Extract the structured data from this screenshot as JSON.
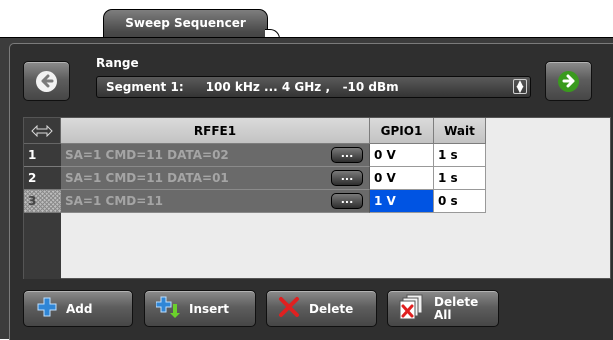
{
  "tab": {
    "label": "Sweep Sequencer"
  },
  "range": {
    "label": "Range",
    "segment_prefix": "Segment 1:",
    "segment_value": "100 kHz ... 4 GHz ,   -10 dBm"
  },
  "table": {
    "columns": {
      "rffe": "RFFE1",
      "gpio": "GPIO1",
      "wait": "Wait"
    },
    "rows": [
      {
        "num": "1",
        "rffe": "SA=1 CMD=11 DATA=02",
        "gpio": "0 V",
        "wait": "1 s"
      },
      {
        "num": "2",
        "rffe": "SA=1 CMD=11 DATA=01",
        "gpio": "0 V",
        "wait": "1 s"
      },
      {
        "num": "3",
        "rffe": "SA=1 CMD=11",
        "gpio": "1 V",
        "wait": "0 s"
      }
    ],
    "edit_button_label": "..."
  },
  "buttons": {
    "add": "Add",
    "insert": "Insert",
    "delete": "Delete",
    "delete_all_line1": "Delete",
    "delete_all_line2": "All"
  },
  "colors": {
    "accent_green": "#3a9a1e",
    "selection_blue": "#0054e3",
    "panel_dark": "#2f2f2f"
  },
  "icons": [
    "arrow-left-icon",
    "arrow-right-icon",
    "resize-columns-icon",
    "add-icon",
    "insert-icon",
    "delete-icon",
    "delete-all-icon",
    "spinner-icon"
  ]
}
